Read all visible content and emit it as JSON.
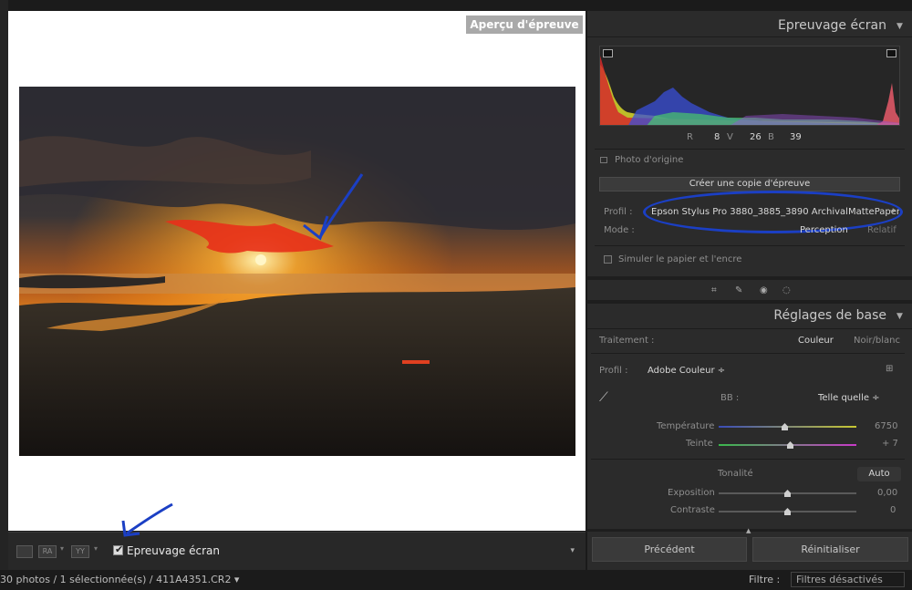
{
  "canvas": {
    "badge": "Aperçu d'épreuve"
  },
  "toolbar": {
    "proof_label": "Epreuvage écran",
    "proof_checked": true,
    "compare_a": "RA",
    "compare_b": "YY"
  },
  "statusbar": {
    "text": "30 photos / 1 sélectionnée(s) / 411A4351.CR2 ▾",
    "filter_label": "Filtre :",
    "filter_value": "Filtres désactivés"
  },
  "soft_proof": {
    "title": "Epreuvage écran",
    "rgb": {
      "r_label": "R",
      "r": "8",
      "g_label": "V",
      "g": "26",
      "b_label": "B",
      "b": "39"
    },
    "origin_label": "Photo d'origine",
    "copy_button": "Créer une copie d'épreuve",
    "profile_label": "Profil :",
    "profile_value": "Epson Stylus Pro 3880_3885_3890 ArchivalMattePaper",
    "mode_label": "Mode :",
    "mode_perception": "Perception",
    "mode_relative": "Relatif",
    "simulate_label": "Simuler le papier et l'encre"
  },
  "basic": {
    "title": "Réglages de base",
    "treatment_label": "Traitement :",
    "treatment_color": "Couleur",
    "treatment_bw": "Noir/blanc",
    "profile_label": "Profil :",
    "profile_value": "Adobe Couleur ÷",
    "wb_label": "BB :",
    "wb_value": "Telle quelle ÷",
    "temp_label": "Température",
    "temp_value": "6750",
    "tint_label": "Teinte",
    "tint_value": "+ 7",
    "tone_label": "Tonalité",
    "auto_label": "Auto",
    "exposure_label": "Exposition",
    "exposure_value": "0,00",
    "contrast_label": "Contraste",
    "contrast_value": "0"
  },
  "buttons": {
    "previous": "Précédent",
    "reset": "Réinitialiser"
  },
  "colors": {
    "annotation": "#1b3fc4",
    "panel": "#2b2b2b"
  }
}
